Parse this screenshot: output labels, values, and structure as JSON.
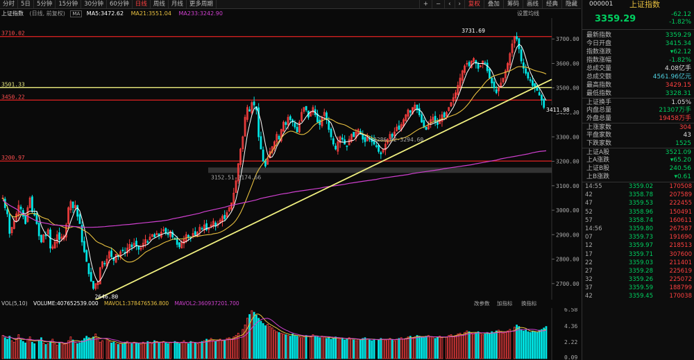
{
  "toolbar": {
    "tabs": [
      "分时",
      "5日",
      "5分钟",
      "15分钟",
      "30分钟",
      "60分钟",
      "日线",
      "周线",
      "月线",
      "更多周期"
    ],
    "active_tab": 6,
    "buttons": [
      "复权",
      "叠加",
      "筹码",
      "画线",
      "经典",
      "隐藏"
    ],
    "active_button": 0,
    "nav_glyphs": [
      "+",
      "−",
      "‹",
      "›"
    ]
  },
  "info": {
    "index_name": "上证指数",
    "mode": "(日线, 前复权)",
    "ma_icon": "MA",
    "ma5": "MA5:3472.62",
    "ma21": "MA21:3551.04",
    "ma233": "MA233:3242.90",
    "settings": "设置均线"
  },
  "vol_info": {
    "title": "VOL(5,10)",
    "volume": "VOLUME:407652539.000",
    "mavol1": "MAVOL1:378476536.800",
    "mavol2": "MAVOL2:360937201.700",
    "btn_params": "改参数",
    "btn_indicator": "加指标",
    "btn_switch": "换指标"
  },
  "colors": {
    "up": "#ff4040",
    "down": "#00e5e5",
    "ma5": "#ffffff",
    "ma21": "#e8c040",
    "ma233": "#d040d0",
    "hline": "#d02020",
    "trend": "#f0f080",
    "down_quote": "#00d060"
  },
  "chart_data": {
    "type": "candlestick",
    "title": "上证指数",
    "y_range": [
      2640,
      3780
    ],
    "y_ticks": [
      2700,
      2800,
      2900,
      3000,
      3100,
      3200,
      3300,
      3400,
      3500,
      3600,
      3700
    ],
    "hlines": [
      {
        "value": 3710.02,
        "label": "3710.02",
        "color": "red"
      },
      {
        "value": 3501.33,
        "label": "3501.33",
        "color": "yellow"
      },
      {
        "value": 3450.22,
        "label": "3450.22",
        "color": "red"
      },
      {
        "value": 3200.97,
        "label": "3200.97",
        "color": "red"
      }
    ],
    "annotations": [
      "3731.69",
      "2646.80",
      "3152.51-3174.66",
      "3286.62-3294.60",
      "3411.98"
    ],
    "last_price": 3411.98,
    "zone_low": 3152.51,
    "zone_high": 3174.66,
    "volume_ticks": [
      "6.58",
      "4.36",
      "2.22",
      "0.09"
    ],
    "closes": [
      3050,
      3010,
      2985,
      2905,
      2930,
      2955,
      2985,
      3020,
      3005,
      2975,
      2945,
      3010,
      3050,
      2995,
      2980,
      2945,
      2895,
      2870,
      2900,
      2895,
      2920,
      2845,
      2850,
      2870,
      2900,
      2880,
      2890,
      2895,
      2940,
      3010,
      3035,
      3010,
      3020,
      2975,
      2945,
      2870,
      2830,
      2790,
      2740,
      2710,
      2680,
      2700,
      2705,
      2765,
      2790,
      2780,
      2800,
      2830,
      2810,
      2795,
      2820,
      2810,
      2830,
      2835,
      2825,
      2845,
      2860,
      2850,
      2865,
      2855,
      2840,
      2845,
      2865,
      2880,
      2870,
      2890,
      2900,
      2890,
      2905,
      2895,
      2910,
      2920,
      2905,
      2900,
      2915,
      2890,
      2880,
      2860,
      2850,
      2870,
      2880,
      2900,
      2890,
      2885,
      2905,
      2900,
      2910,
      2930,
      2925,
      2940,
      2920,
      2925,
      2940,
      2955,
      2935,
      2945,
      2960,
      2975,
      2965,
      2990,
      3010,
      3030,
      3070,
      3120,
      3190,
      3250,
      3300,
      3380,
      3420,
      3405,
      3440,
      3430,
      3410,
      3300,
      3250,
      3200,
      3180,
      3210,
      3240,
      3260,
      3280,
      3310,
      3290,
      3330,
      3360,
      3350,
      3380,
      3370,
      3360,
      3340,
      3320,
      3360,
      3400,
      3420,
      3410,
      3380,
      3400,
      3420,
      3390,
      3360,
      3350,
      3380,
      3400,
      3370,
      3330,
      3300,
      3270,
      3250,
      3280,
      3300,
      3290,
      3270,
      3260,
      3290,
      3310,
      3300,
      3320,
      3330,
      3310,
      3290,
      3280,
      3300,
      3290,
      3280,
      3270,
      3260,
      3240,
      3230,
      3250,
      3270,
      3290,
      3310,
      3300,
      3320,
      3340,
      3330,
      3350,
      3370,
      3390,
      3410,
      3400,
      3420,
      3430,
      3410,
      3390,
      3360,
      3340,
      3330,
      3350,
      3370,
      3380,
      3360,
      3350,
      3370,
      3390,
      3380,
      3400,
      3420,
      3440,
      3460,
      3480,
      3510,
      3540,
      3570,
      3590,
      3600,
      3590,
      3610,
      3620,
      3600,
      3580,
      3590,
      3610,
      3600,
      3570,
      3540,
      3520,
      3500,
      3480,
      3500,
      3520,
      3540,
      3570,
      3600,
      3640,
      3680,
      3710,
      3700,
      3660,
      3610,
      3580,
      3560,
      3540,
      3530,
      3510,
      3500,
      3490,
      3470,
      3450,
      3420,
      3411.98
    ],
    "ma233": [
      3040,
      3020,
      3005,
      2990,
      2975,
      2960,
      2950,
      2945,
      2940,
      2938,
      2936,
      2934,
      2932,
      2930,
      2930,
      2931,
      2933,
      2935,
      2937,
      2940,
      2942,
      2945,
      2947,
      2950,
      2953,
      2956,
      2960,
      2965,
      2970,
      2976,
      2982,
      2988,
      2994,
      3000,
      3006,
      3012,
      3018,
      3024,
      3030,
      3036,
      3042,
      3048,
      3054,
      3060,
      3066,
      3070,
      3074,
      3078,
      3082,
      3086,
      3090,
      3094,
      3098,
      3102,
      3106,
      3110,
      3114,
      3118,
      3122,
      3126,
      3130,
      3134,
      3138,
      3142,
      3146,
      3150,
      3154,
      3158,
      3162,
      3166,
      3170,
      3174,
      3178,
      3182,
      3186,
      3190,
      3195,
      3200,
      3205,
      3210,
      3215,
      3220,
      3225,
      3230,
      3235,
      3240,
      3243
    ],
    "volumes": [
      3.1,
      2.8,
      2.6,
      3.0,
      2.4,
      2.2,
      2.7,
      3.2,
      2.5,
      2.3,
      2.1,
      2.6,
      2.9,
      2.2,
      2.0,
      2.4,
      2.8,
      2.1,
      1.9,
      2.0,
      2.3,
      2.6,
      2.0,
      1.8,
      2.1,
      2.2,
      1.9,
      2.0,
      2.4,
      2.9,
      2.5,
      2.2,
      2.0,
      2.1,
      2.4,
      2.7,
      3.0,
      2.8,
      2.6,
      2.9,
      3.3,
      2.7,
      2.2,
      2.4,
      2.6,
      2.3,
      2.1,
      2.2,
      2.0,
      1.9,
      2.1,
      2.0,
      2.2,
      2.3,
      2.1,
      2.0,
      2.2,
      2.1,
      2.0,
      1.9,
      2.2,
      2.1,
      2.3,
      2.2,
      2.0,
      2.4,
      2.3,
      2.1,
      2.2,
      2.3,
      2.1,
      2.0,
      2.2,
      2.3,
      2.1,
      2.0,
      2.2,
      2.4,
      2.1,
      2.0,
      2.3,
      2.2,
      2.1,
      2.0,
      2.2,
      2.3,
      2.4,
      2.6,
      2.5,
      2.7,
      2.4,
      2.3,
      2.5,
      2.6,
      2.4,
      2.5,
      2.7,
      2.8,
      2.6,
      2.9,
      3.1,
      3.4,
      3.9,
      4.5,
      5.4,
      5.9,
      6.4,
      6.2,
      5.8,
      5.4,
      5.0,
      4.7,
      4.4,
      4.6,
      4.3,
      4.1,
      3.8,
      3.6,
      3.5,
      3.4,
      3.3,
      3.2,
      3.1,
      3.0,
      3.3,
      3.1,
      3.0,
      2.9,
      2.8,
      3.0,
      3.1,
      2.9,
      3.2,
      3.0,
      2.9,
      2.8,
      3.0,
      2.9,
      2.7,
      2.8,
      2.6,
      2.7,
      2.9,
      2.8,
      2.6,
      2.7,
      2.5,
      2.6,
      2.8,
      2.7,
      2.5,
      2.4,
      2.6,
      2.5,
      2.7,
      2.8,
      2.6,
      2.5,
      2.4,
      2.6,
      2.5,
      2.7,
      2.6,
      2.5,
      2.6,
      2.7,
      2.5,
      2.4,
      2.6,
      2.7,
      2.8,
      2.6,
      2.7,
      2.9,
      3.0,
      2.8,
      2.9,
      3.1,
      3.0,
      2.9,
      2.8,
      3.0,
      3.1,
      2.9,
      2.8,
      2.7,
      2.9,
      3.0,
      2.8,
      2.9,
      3.1,
      3.2,
      3.0,
      3.1,
      3.3,
      3.4,
      3.2,
      3.5,
      3.7,
      3.6,
      3.4,
      3.3,
      3.5,
      3.6,
      3.4,
      3.2,
      3.3,
      3.5,
      3.4,
      3.6,
      3.5,
      3.7,
      3.8,
      3.6,
      3.4,
      3.5,
      3.7,
      3.9,
      4.2,
      4.5,
      4.3,
      3.9,
      3.7,
      3.8,
      3.6,
      3.5,
      3.7,
      3.6,
      3.5,
      3.8,
      3.9,
      4.1,
      4.3
    ]
  },
  "quote": {
    "code": "000001",
    "name": "上证指数",
    "price": "3359.29",
    "change": "-62.12",
    "pct": "-1.82%"
  },
  "stats": [
    {
      "k": "最新指数",
      "v": "3359.29",
      "c": "g"
    },
    {
      "k": "今日开盘",
      "v": "3415.34",
      "c": "g"
    },
    {
      "k": "指数涨跌",
      "v": "▾62.12",
      "c": "g"
    },
    {
      "k": "指数涨幅",
      "v": "-1.82%",
      "c": "g"
    },
    {
      "k": "总成交量",
      "v": "4.08亿手",
      "c": "w"
    },
    {
      "k": "总成交额",
      "v": "4561.96亿元",
      "c": "c"
    },
    {
      "k": "最高指数",
      "v": "3429.15",
      "c": "r"
    },
    {
      "k": "最低指数",
      "v": "3328.31",
      "c": "g"
    },
    {
      "k": "上证换手",
      "v": "1.05%",
      "c": "w",
      "sep": true
    },
    {
      "k": "内盘总量",
      "v": "21307万手",
      "c": "g"
    },
    {
      "k": "外盘总量",
      "v": "19458万手",
      "c": "r"
    },
    {
      "k": "上涨家数",
      "v": "304",
      "c": "r",
      "sep": true
    },
    {
      "k": "平盘家数",
      "v": "43",
      "c": "w"
    },
    {
      "k": "下跌家数",
      "v": "1525",
      "c": "g"
    },
    {
      "k": "上证A股",
      "v": "3521.09",
      "c": "g",
      "sep": true
    },
    {
      "k": "上A涨跌",
      "v": "▾65.20",
      "c": "g"
    },
    {
      "k": "上证B股",
      "v": "240.56",
      "c": "g"
    },
    {
      "k": "上B涨跌",
      "v": "▾0.61",
      "c": "g"
    }
  ],
  "ticks": [
    {
      "t": "14:55",
      "p": "3359.02",
      "v": "170508"
    },
    {
      "t": "42",
      "p": "3358.78",
      "v": "207589"
    },
    {
      "t": "47",
      "p": "3359.53",
      "v": "222455"
    },
    {
      "t": "52",
      "p": "3358.96",
      "v": "150491"
    },
    {
      "t": "57",
      "p": "3358.74",
      "v": "160611"
    },
    {
      "t": "14:56",
      "p": "3359.80",
      "v": "267587"
    },
    {
      "t": "07",
      "p": "3359.73",
      "v": "191690"
    },
    {
      "t": "12",
      "p": "3359.97",
      "v": "218513"
    },
    {
      "t": "17",
      "p": "3359.71",
      "v": "307600"
    },
    {
      "t": "22",
      "p": "3359.03",
      "v": "211401"
    },
    {
      "t": "27",
      "p": "3359.28",
      "v": "225619"
    },
    {
      "t": "32",
      "p": "3359.26",
      "v": "225072"
    },
    {
      "t": "37",
      "p": "3359.59",
      "v": "188799"
    },
    {
      "t": "42",
      "p": "3359.45",
      "v": "170038"
    }
  ]
}
